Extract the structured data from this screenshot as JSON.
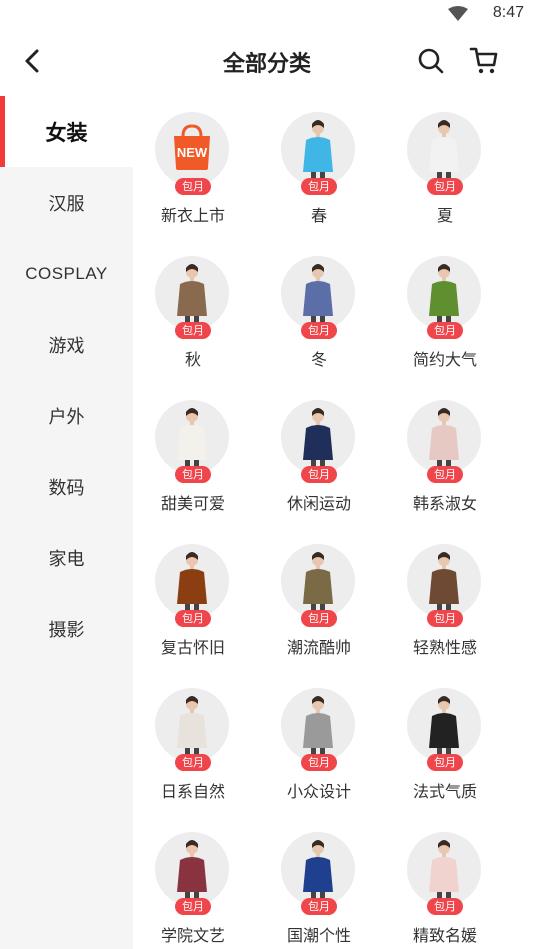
{
  "status_bar": {
    "time": "8:47"
  },
  "header": {
    "title": "全部分类"
  },
  "sidebar": {
    "items": [
      {
        "label": "女装",
        "active": true
      },
      {
        "label": "汉服"
      },
      {
        "label": "COSPLAY"
      },
      {
        "label": "游戏"
      },
      {
        "label": "户外"
      },
      {
        "label": "数码"
      },
      {
        "label": "家电"
      },
      {
        "label": "摄影"
      }
    ]
  },
  "categories": {
    "items": [
      {
        "label": "新衣上市",
        "badge": "包月",
        "icon": "new-bag-icon",
        "new_text": "NEW"
      },
      {
        "label": "春",
        "badge": "包月",
        "icon": "model-photo"
      },
      {
        "label": "夏",
        "badge": "包月",
        "icon": "model-photo"
      },
      {
        "label": "秋",
        "badge": "包月",
        "icon": "model-photo"
      },
      {
        "label": "冬",
        "badge": "包月",
        "icon": "model-photo"
      },
      {
        "label": "简约大气",
        "badge": "包月",
        "icon": "model-photo"
      },
      {
        "label": "甜美可爱",
        "badge": "包月",
        "icon": "model-photo"
      },
      {
        "label": "休闲运动",
        "badge": "包月",
        "icon": "model-photo"
      },
      {
        "label": "韩系淑女",
        "badge": "包月",
        "icon": "model-photo"
      },
      {
        "label": "复古怀旧",
        "badge": "包月",
        "icon": "model-photo"
      },
      {
        "label": "潮流酷帅",
        "badge": "包月",
        "icon": "model-photo"
      },
      {
        "label": "轻熟性感",
        "badge": "包月",
        "icon": "model-photo"
      },
      {
        "label": "日系自然",
        "badge": "包月",
        "icon": "model-photo"
      },
      {
        "label": "小众设计",
        "badge": "包月",
        "icon": "model-photo"
      },
      {
        "label": "法式气质",
        "badge": "包月",
        "icon": "model-photo"
      },
      {
        "label": "学院文艺",
        "badge": "包月",
        "icon": "model-photo"
      },
      {
        "label": "国潮个性",
        "badge": "包月",
        "icon": "model-photo"
      },
      {
        "label": "精致名媛",
        "badge": "包月",
        "icon": "model-photo"
      }
    ]
  },
  "colors": {
    "accent": "#f23a3a",
    "badge": "#f0454a",
    "outfits": [
      "#f05a28",
      "#3fb6e6",
      "#f2f2f2",
      "#8a6a4e",
      "#5b6ea8",
      "#5f8f2e",
      "#f4f0ec",
      "#1f2f5a",
      "#e7c9c4",
      "#8a3e12",
      "#7a6a45",
      "#6e4a34",
      "#e8e2dc",
      "#9a9a9a",
      "#222222",
      "#8a3340",
      "#1f3f8f",
      "#f0d2cf"
    ]
  }
}
